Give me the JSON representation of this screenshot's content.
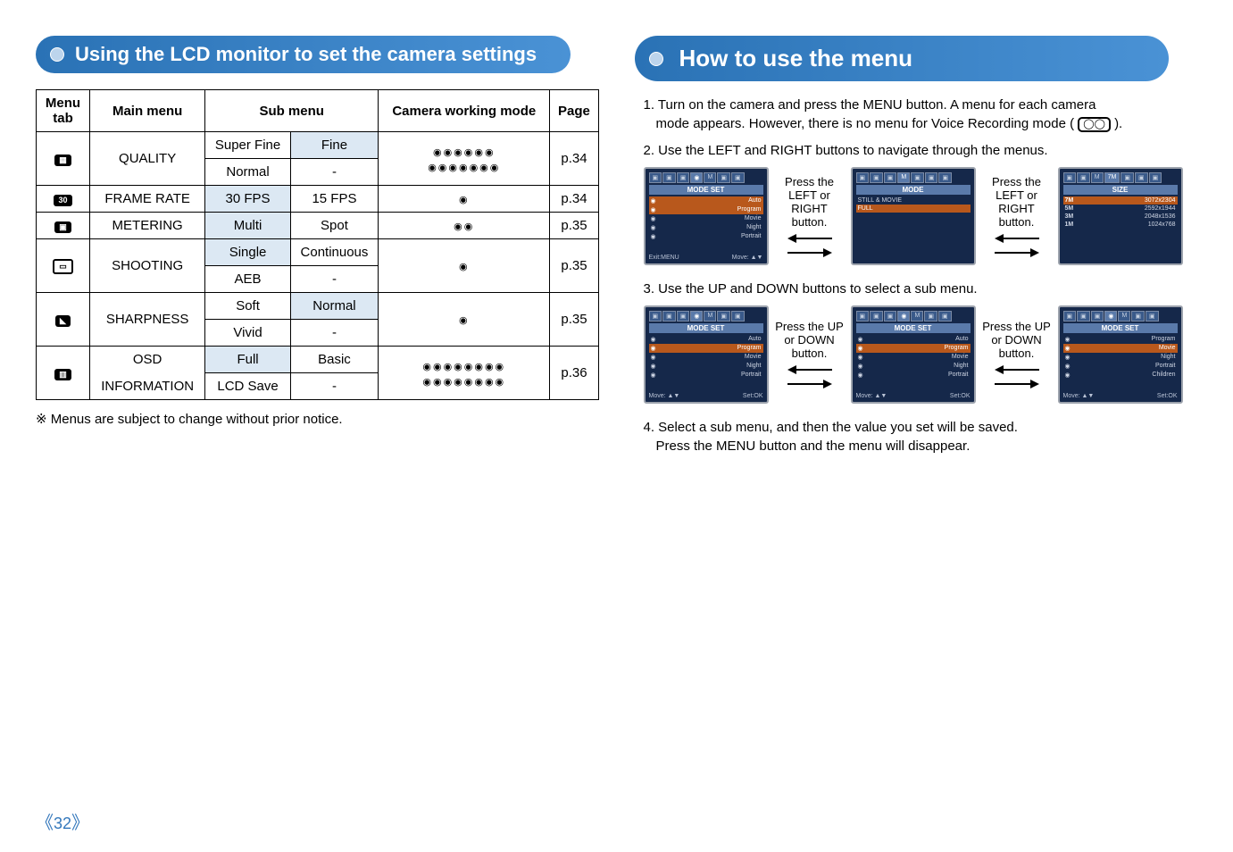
{
  "left": {
    "title": "Using the LCD monitor to set the camera settings",
    "headers": [
      "Menu tab",
      "Main menu",
      "Sub menu",
      "Camera working mode",
      "Page"
    ],
    "rows": [
      {
        "icon": "quality-icon",
        "main": "QUALITY",
        "subs": [
          {
            "s1": "Super Fine",
            "s2": "Fine"
          },
          {
            "s1": "Normal",
            "s2": "-"
          }
        ],
        "page": "p.34"
      },
      {
        "icon": "frame-rate-icon",
        "main": "FRAME RATE",
        "subs": [
          {
            "s1": "30 FPS",
            "s2": "15 FPS"
          }
        ],
        "page": "p.34"
      },
      {
        "icon": "metering-icon",
        "main": "METERING",
        "subs": [
          {
            "s1": "Multi",
            "s2": "Spot"
          }
        ],
        "page": "p.35"
      },
      {
        "icon": "shooting-icon",
        "main": "SHOOTING",
        "subs": [
          {
            "s1": "Single",
            "s2": "Continuous"
          },
          {
            "s1": "AEB",
            "s2": "-"
          }
        ],
        "page": "p.35"
      },
      {
        "icon": "sharpness-icon",
        "main": "SHARPNESS",
        "subs": [
          {
            "s1": "Soft",
            "s2": "Normal"
          },
          {
            "s1": "Vivid",
            "s2": "-"
          }
        ],
        "page": "p.35"
      },
      {
        "icon": "osd-icon",
        "main": "OSD INFORMATION",
        "main1": "OSD",
        "main2": "INFORMATION",
        "subs": [
          {
            "s1": "Full",
            "s2": "Basic"
          },
          {
            "s1": "LCD Save",
            "s2": "-"
          }
        ],
        "page": "p.36"
      }
    ],
    "footnote_symbol": "※",
    "footnote": "Menus are subject to change without prior notice."
  },
  "right": {
    "title": "How to use the menu",
    "step1_line1": "1. Turn on the camera and press the MENU button. A menu for each camera",
    "step1_line2": "mode appears. However, there is no menu for Voice Recording mode (",
    "step1_line3": ").",
    "step2": "2. Use the LEFT and RIGHT buttons to navigate through the menus.",
    "step3": "3. Use the UP and DOWN buttons to select a sub menu.",
    "step4_line1": "4. Select a sub menu, and then the value you set will be saved.",
    "step4_line2": "Press the MENU button and the menu will disappear.",
    "inter1": "Press the LEFT or RIGHT button.",
    "inter2": "Press the UP or DOWN button.",
    "screenA": {
      "banner": "MODE SET",
      "rows": [
        {
          "l": "",
          "r": "Auto",
          "hl": true
        },
        {
          "l": "",
          "r": "Program",
          "hl": true
        },
        {
          "l": "",
          "r": "Movie"
        },
        {
          "l": "",
          "r": "Night"
        },
        {
          "l": "",
          "r": "Portrait"
        }
      ],
      "footL": "Exit:MENU",
      "footR": "Move: ▲▼"
    },
    "screenB": {
      "banner": "MODE",
      "rows": [
        {
          "l": "STILL & MOVIE",
          "r": ""
        },
        {
          "l": "FULL",
          "r": "",
          "hl": true
        }
      ]
    },
    "screenC": {
      "banner": "SIZE",
      "rows": [
        {
          "l": "7M",
          "r": "3072x2304",
          "hl": true
        },
        {
          "l": "5M",
          "r": "2592x1944"
        },
        {
          "l": "3M",
          "r": "2048x1536"
        },
        {
          "l": "1M",
          "r": "1024x768"
        }
      ]
    },
    "screenD": {
      "banner": "MODE SET",
      "rows": [
        {
          "l": "",
          "r": "Auto"
        },
        {
          "l": "",
          "r": "Program",
          "hl": true
        },
        {
          "l": "",
          "r": "Movie"
        },
        {
          "l": "",
          "r": "Night"
        },
        {
          "l": "",
          "r": "Portrait"
        }
      ],
      "footL": "Move: ▲▼",
      "footR": "Set:OK"
    },
    "screenE": {
      "banner": "MODE SET",
      "rows": [
        {
          "l": "",
          "r": "Auto"
        },
        {
          "l": "",
          "r": "Program",
          "hl": true
        },
        {
          "l": "",
          "r": "Movie"
        },
        {
          "l": "",
          "r": "Night"
        },
        {
          "l": "",
          "r": "Portrait"
        }
      ],
      "footL": "Move: ▲▼",
      "footR": "Set:OK"
    },
    "screenF": {
      "banner": "MODE SET",
      "rows": [
        {
          "l": "",
          "r": "Program"
        },
        {
          "l": "",
          "r": "Movie",
          "hl": true
        },
        {
          "l": "",
          "r": "Night"
        },
        {
          "l": "",
          "r": "Portrait"
        },
        {
          "l": "",
          "r": "Children"
        }
      ],
      "footL": "Move: ▲▼",
      "footR": "Set:OK"
    }
  },
  "pageNumber": "32"
}
